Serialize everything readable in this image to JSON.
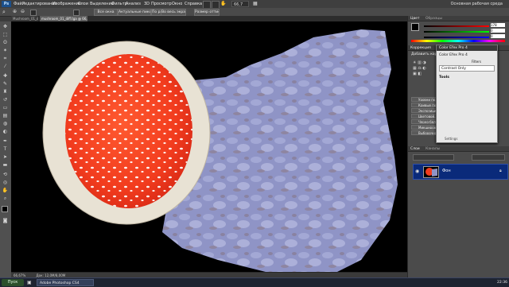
{
  "app": {
    "logo": "Ps",
    "zoom": "66,7",
    "workspace": "Основная рабочая среда"
  },
  "menu": [
    "Файл",
    "Редактирование",
    "Изображение",
    "Слои",
    "Выделение",
    "Фильтр",
    "Анализ",
    "3D",
    "Просмотр",
    "Окно",
    "Справка"
  ],
  "options": {
    "btn1": "Все окна",
    "btn2": "Актуальные пикселы",
    "btn3": "По размеру экрана",
    "btn4": "Во весь экран",
    "btn5": "Размер оттиска"
  },
  "tabs": {
    "doc1": "Mushroom_01_diff @ 25,1% (RGB/8)",
    "doc2": "mushroom_01_diff.tga @ 66,7% (RGB/8)"
  },
  "status": {
    "zoom": "66,67%",
    "doc": "Док: 12,0M/8,00M"
  },
  "panels": {
    "color_tab": "Цвет",
    "swatches_tab": "Образцы",
    "color_values": [
      "178",
      "0",
      "0"
    ],
    "adjust_tab": "Коррекция",
    "adjust_title": "Добавить корр",
    "list_items": [
      "Уровни по...",
      "Кривые по...",
      "Экспозиция...",
      "Цветовой...",
      "Черно-бел...",
      "Микширова...",
      "Выборочная коррекция цвета изображения"
    ],
    "layers_tab": "Слои",
    "channels_tab": "Каналы",
    "layer_name": "Фон"
  },
  "popup": {
    "title": "Color Efex Pro 4",
    "item1": "Color Efex Pro 4",
    "filters": "Filters",
    "restore": "Restore",
    "contrast_only": "Contrast Only",
    "tools": "Tools",
    "settings": "Settings"
  },
  "taskbar": {
    "start": "Пуск",
    "task1": "Adobe Photoshop CS4",
    "clock": "22:36"
  },
  "colors": {
    "accent": "#0a2a7a",
    "cap_red": "#f23c1e",
    "stem_blue": "#8f94c6"
  }
}
